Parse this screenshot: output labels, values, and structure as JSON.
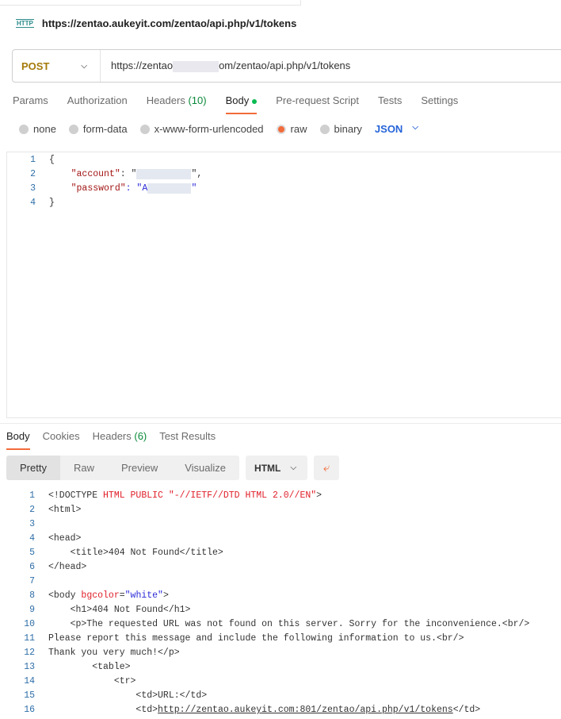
{
  "title_url": "https://zentao.aukeyit.com/zentao/api.php/v1/tokens",
  "request": {
    "method": "POST",
    "url_prefix": "https://zentao",
    "url_suffix": "om/zentao/api.php/v1/tokens"
  },
  "tabs": [
    {
      "label": "Params"
    },
    {
      "label": "Authorization"
    },
    {
      "label": "Headers",
      "count": "(10)"
    },
    {
      "label": "Body"
    },
    {
      "label": "Pre-request Script"
    },
    {
      "label": "Tests"
    },
    {
      "label": "Settings"
    }
  ],
  "body_types": [
    "none",
    "form-data",
    "x-www-form-urlencoded",
    "raw",
    "binary"
  ],
  "body_format": "JSON",
  "request_body": [
    [
      {
        "t": "{",
        "c": "k"
      }
    ],
    [
      {
        "t": "    ",
        "c": "k"
      },
      {
        "t": "\"account\"",
        "c": "str"
      },
      {
        "t": ": \"",
        "c": "k"
      },
      {
        "t": "          ",
        "c": "blurred"
      },
      {
        "t": "\",",
        "c": "k"
      }
    ],
    [
      {
        "t": "    ",
        "c": "k"
      },
      {
        "t": "\"password\"",
        "c": "str"
      },
      {
        "t": ": \"A",
        "c": "s"
      },
      {
        "t": "        ",
        "c": "blurred"
      },
      {
        "t": "\"",
        "c": "s"
      }
    ],
    [
      {
        "t": "}",
        "c": "k"
      }
    ]
  ],
  "response_tabs": [
    {
      "label": "Body"
    },
    {
      "label": "Cookies"
    },
    {
      "label": "Headers",
      "count": "(6)"
    },
    {
      "label": "Test Results"
    }
  ],
  "view_modes": [
    "Pretty",
    "Raw",
    "Preview",
    "Visualize"
  ],
  "response_format": "HTML",
  "response_body": [
    [
      {
        "t": "<!DOCTYPE ",
        "c": "k"
      },
      {
        "t": "HTML PUBLIC \"-//IETF//DTD HTML 2.0//EN\"",
        "c": "r"
      },
      {
        "t": ">",
        "c": "k"
      }
    ],
    [
      {
        "t": "<html>",
        "c": "k"
      }
    ],
    [],
    [
      {
        "t": "<head>",
        "c": "k"
      }
    ],
    [
      {
        "t": "    <title>404 Not Found</title>",
        "c": "k"
      }
    ],
    [
      {
        "t": "</head>",
        "c": "k"
      }
    ],
    [],
    [
      {
        "t": "<body ",
        "c": "k"
      },
      {
        "t": "bgcolor",
        "c": "a"
      },
      {
        "t": "=",
        "c": "k"
      },
      {
        "t": "\"white\"",
        "c": "s"
      },
      {
        "t": ">",
        "c": "k"
      }
    ],
    [
      {
        "t": "    <h1>404 Not Found</h1>",
        "c": "k"
      }
    ],
    [
      {
        "t": "    <p>The requested URL was not found on this server. Sorry for the inconvenience.<br/>",
        "c": "k"
      }
    ],
    [
      {
        "t": "Please report this message and include the following information to us.<br/>",
        "c": "k"
      }
    ],
    [
      {
        "t": "Thank you very much!</p>",
        "c": "k"
      }
    ],
    [
      {
        "t": "        <table>",
        "c": "k"
      }
    ],
    [
      {
        "t": "            <tr>",
        "c": "k"
      }
    ],
    [
      {
        "t": "                <td>URL:</td>",
        "c": "k"
      }
    ],
    [
      {
        "t": "                <td>",
        "c": "k"
      },
      {
        "t": "http://zentao.aukeyit.com:801/zentao/api.php/v1/tokens",
        "c": "k ul"
      },
      {
        "t": "</td>",
        "c": "k"
      }
    ]
  ]
}
